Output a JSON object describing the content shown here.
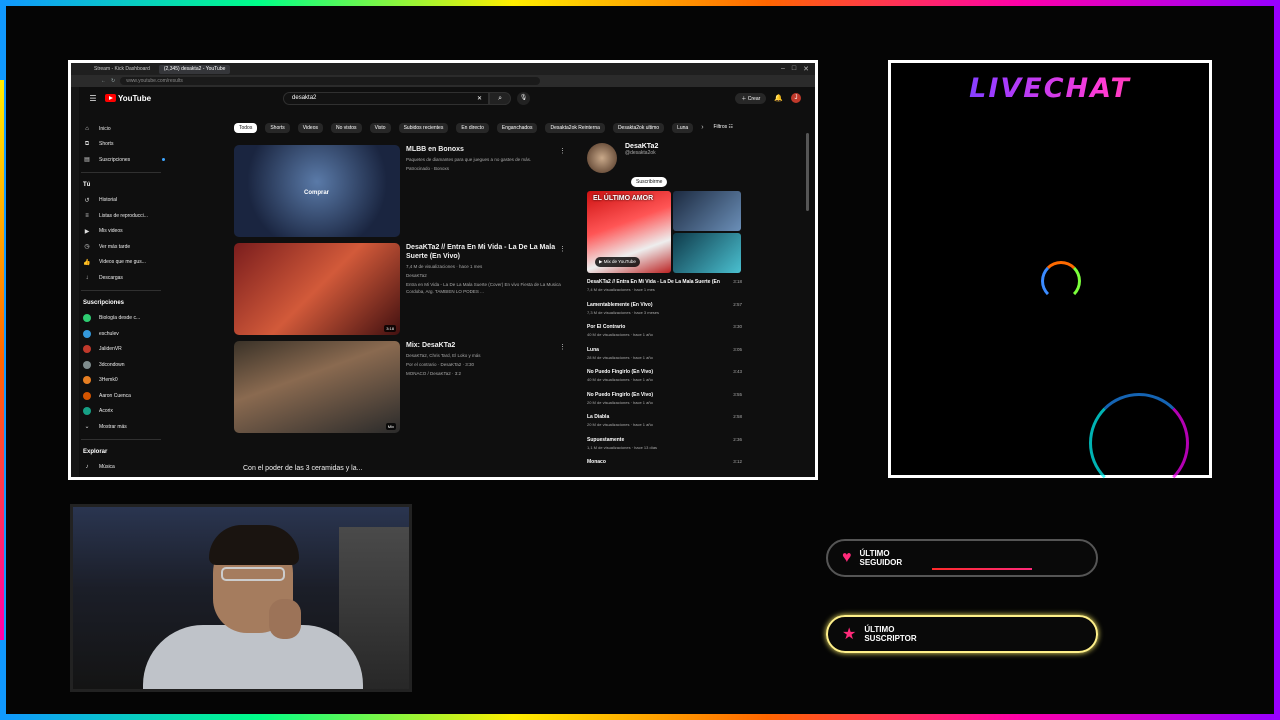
{
  "browser": {
    "tabs": [
      "Stream - Kick Dashboard",
      "(2,345) desakta2 - YouTube"
    ],
    "url": "www.youtube.com/results"
  },
  "youtube": {
    "logo": "YouTube",
    "search_query": "desakta2",
    "create_label": "Crear",
    "avatar_initial": "J",
    "sidebar": {
      "main": [
        "Inicio",
        "Shorts",
        "Suscripciones"
      ],
      "you_header": "Tú",
      "you": [
        "Historial",
        "Listas de reproducci...",
        "Mis videos",
        "Ver más tarde",
        "Videos que me gus...",
        "Descargas"
      ],
      "subs_header": "Suscripciones",
      "subs": [
        "Biología desde c...",
        "eschulev",
        "JalidenVR",
        "3dcondown",
        "3Hemk0",
        "Aaron Cuenca",
        "Acorix",
        "Mostrar más"
      ],
      "explore_header": "Explorar",
      "explore": [
        "Música"
      ]
    },
    "chips": [
      "Todos",
      "Shorts",
      "Videos",
      "No vistos",
      "Visto",
      "Subidos recientes",
      "En directo",
      "Enganchados",
      "Desakta2ok Reinterna",
      "Desakta2ok ultimo",
      "Luna"
    ],
    "filters_label": "Filtros",
    "results": [
      {
        "title": "MLBB en Bonoxs",
        "meta": "Paquetes de diamantes para que juegues a no gastes de más.",
        "sub": "Patrocinado · Bonoxs",
        "thumb_label": "Comprar"
      },
      {
        "title": "DesaKTa2 // Entra En Mi Vida - La De La Mala Suerte (En Vivo)",
        "meta": "7,4 M de visualizaciones · hace 1 mes",
        "channel": "DesaKTa2",
        "desc": "Entra en Mi Vida - La De La Mala Suerte (Cover) En vivo Fiesta de La Musica Cordoba, Arg. TAMBIEN LO PODES ...",
        "duration": "3:18"
      },
      {
        "title": "Mix: DesaKTa2",
        "meta": "DesaKTa2, Chris Tard, El Loko y más",
        "desc": "Por el contrario · DesaKTa2 · 3:30",
        "sub": "MONACO / DesaKTa2 · 3:2",
        "duration": "Mix"
      }
    ],
    "last_title": "Con el poder de las 3 ceramidas y la...",
    "channel": {
      "name": "DesaKTa2",
      "handle": "@desakta2ok",
      "subscribe": "Suscribirme",
      "big_thumb": "EL ÚLTIMO AMOR",
      "mix_label": "Mix de YouTube",
      "songs": [
        {
          "title": "DesaKTa2 // Entra En Mi Vida - La De La Mala Suerte (En",
          "meta": "7,4 M de visualizaciones · hace 1 mes",
          "duration": "3:18"
        },
        {
          "title": "Lamentablemente (En Vivo)",
          "meta": "7,3 M de visualizaciones · hace 3 meses",
          "duration": "2:57"
        },
        {
          "title": "Por El Contrario",
          "meta": "40 M de visualizaciones · hace 1 año",
          "duration": "3:30"
        },
        {
          "title": "Luna",
          "meta": "28 M de visualizaciones · hace 1 año",
          "duration": "3:05"
        },
        {
          "title": "No Puedo Fingirlo (En Vivo)",
          "meta": "40 M de visualizaciones · hace 1 año",
          "duration": "3:43"
        },
        {
          "title": "No Puedo Fingirlo (En Vivo)",
          "meta": "20 M de visualizaciones · hace 1 año",
          "duration": "3:55"
        },
        {
          "title": "La Diabla",
          "meta": "20 M de visualizaciones · hace 1 año",
          "duration": "2:58"
        },
        {
          "title": "Supuestamente",
          "meta": "1,1 M de visualizaciones · hace 13 días",
          "duration": "2:36"
        },
        {
          "title": "Monaco",
          "meta": "",
          "duration": "3:12"
        }
      ]
    }
  },
  "livechat": {
    "title": "LIVECHAT"
  },
  "alerts": {
    "follower": "ÚLTIMO SEGUIDOR",
    "subscriber": "ÚLTIMO SUSCRIPTOR"
  }
}
